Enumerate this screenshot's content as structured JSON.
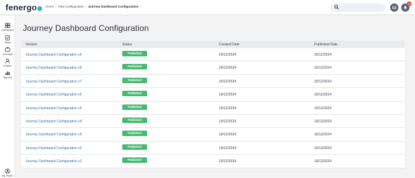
{
  "app": {
    "logo_text": "fenergo",
    "colors": {
      "accent": "#2fb9a6",
      "published": "#49b972",
      "link": "#2f6fb3",
      "notification": "#e2503e"
    }
  },
  "breadcrumb": {
    "items": [
      "Home",
      "View Configuration",
      "Journey Dashboard Configuration"
    ],
    "separator": "/"
  },
  "search": {
    "value": "",
    "placeholder": ""
  },
  "topbar": {
    "notification_count": "6"
  },
  "sidebar": {
    "items": [
      {
        "label": "Dashboard",
        "icon": "dashboard-icon"
      },
      {
        "label": "Tasks",
        "icon": "tasks-icon"
      },
      {
        "label": "Journeys",
        "icon": "journeys-icon"
      },
      {
        "label": "Entities",
        "icon": "entities-icon"
      },
      {
        "label": "Reports",
        "icon": "reports-icon"
      }
    ],
    "profile_label": "My Profile"
  },
  "main": {
    "title": "Journey Dashboard Configuration",
    "table": {
      "headers": [
        "Version",
        "Status",
        "Created Date",
        "Published Date"
      ],
      "rows": [
        {
          "version": "Journey Dashboard Configuration v9",
          "status": "Published",
          "created": "20/12/2024",
          "published": "20/12/2024"
        },
        {
          "version": "Journey Dashboard Configuration v8",
          "status": "Published",
          "created": "20/12/2024",
          "published": "20/12/2024"
        },
        {
          "version": "Journey Dashboard Configuration v7",
          "status": "Published",
          "created": "20/12/2024",
          "published": "20/12/2024"
        },
        {
          "version": "Journey Dashboard Configuration v6",
          "status": "Published",
          "created": "19/12/2024",
          "published": "20/12/2024"
        },
        {
          "version": "Journey Dashboard Configuration v5",
          "status": "Published",
          "created": "19/12/2024",
          "published": "19/12/2024"
        },
        {
          "version": "Journey Dashboard Configuration v4",
          "status": "Published",
          "created": "19/12/2024",
          "published": "19/12/2024"
        },
        {
          "version": "Journey Dashboard Configuration v3",
          "status": "Published",
          "created": "19/12/2024",
          "published": "19/12/2024"
        },
        {
          "version": "Journey Dashboard Configuration v2",
          "status": "Published",
          "created": "19/12/2024",
          "published": "19/12/2024"
        },
        {
          "version": "Journey Dashboard Configuration v1",
          "status": "Published",
          "created": "19/12/2024",
          "published": "19/12/2024"
        }
      ]
    }
  }
}
